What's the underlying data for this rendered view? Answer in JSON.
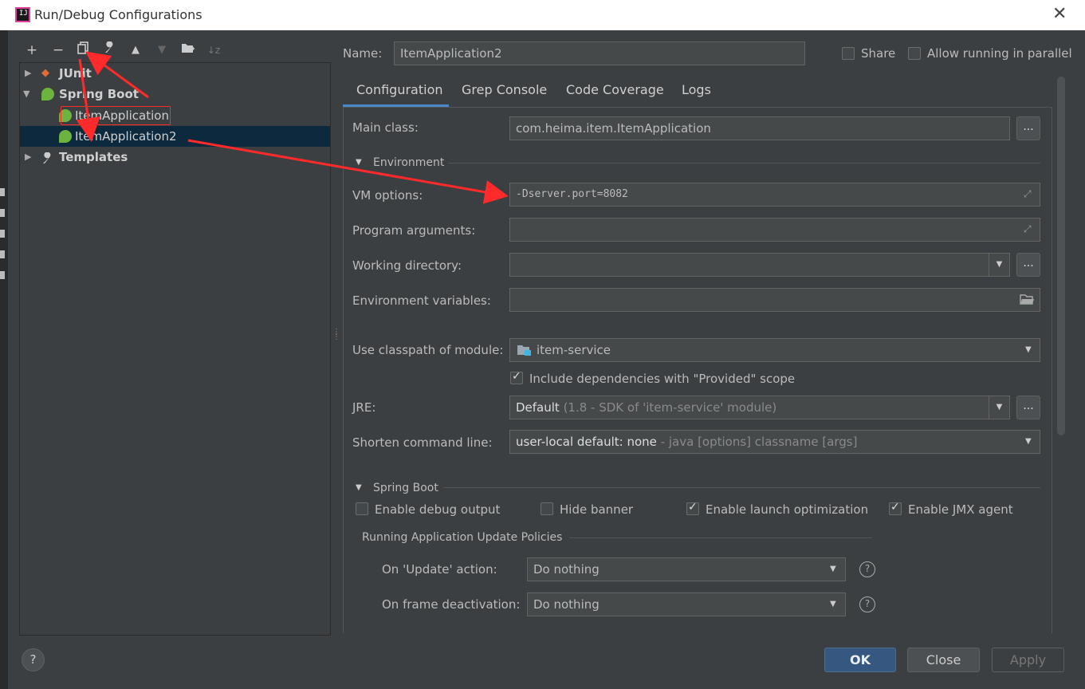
{
  "window": {
    "title": "Run/Debug Configurations",
    "icon": "intellij-icon",
    "icon_text": "IJ"
  },
  "toolbar": {
    "add": "+",
    "remove": "−",
    "copy": "⧉",
    "edit": "🔧",
    "up": "▲",
    "down": "▼",
    "folder": "📁",
    "sort": "↓z"
  },
  "tree": {
    "junit": "JUnit",
    "spring_boot": "Spring Boot",
    "item1": "ItemApplication",
    "item2": "ItemApplication2",
    "templates": "Templates"
  },
  "name": {
    "label": "Name:",
    "value": "ItemApplication2"
  },
  "share": {
    "label": "Share",
    "checked": false
  },
  "parallel": {
    "label": "Allow running in parallel",
    "checked": false
  },
  "tabs": [
    "Configuration",
    "Grep Console",
    "Code Coverage",
    "Logs"
  ],
  "config": {
    "main_class_label": "Main class:",
    "main_class": "com.heima.item.ItemApplication",
    "environment_header": "Environment",
    "vm_options_label": "VM options:",
    "vm_options": "-Dserver.port=8082",
    "program_args_label": "Program arguments:",
    "program_args": "",
    "working_dir_label": "Working directory:",
    "working_dir": "",
    "env_vars_label": "Environment variables:",
    "env_vars": "",
    "classpath_label": "Use classpath of module:",
    "classpath": "item-service",
    "include_deps": "Include dependencies with \"Provided\" scope",
    "jre_label": "JRE:",
    "jre_main": "Default",
    "jre_detail": " (1.8 - SDK of 'item-service' module)",
    "shorten_label": "Shorten command line:",
    "shorten_main": "user-local default: none",
    "shorten_detail": " - java [options] classname [args]",
    "spring_boot_header": "Spring Boot",
    "debug_output": "Enable debug output",
    "hide_banner": "Hide banner",
    "launch_opt": "Enable launch optimization",
    "jmx": "Enable JMX agent",
    "update_policies_header": "Running Application Update Policies",
    "on_update_label": "On 'Update' action:",
    "on_update": "Do nothing",
    "on_frame_label": "On frame deactivation:",
    "on_frame": "Do nothing"
  },
  "buttons": {
    "ok": "OK",
    "close": "Close",
    "apply": "Apply",
    "help": "?",
    "dots": "..."
  },
  "colors": {
    "bg": "#3c3f41",
    "field": "#45494a",
    "selection": "#0d293e",
    "ok": "#365880",
    "annotation": "#ff2a2a",
    "spring": "#6db33f"
  }
}
